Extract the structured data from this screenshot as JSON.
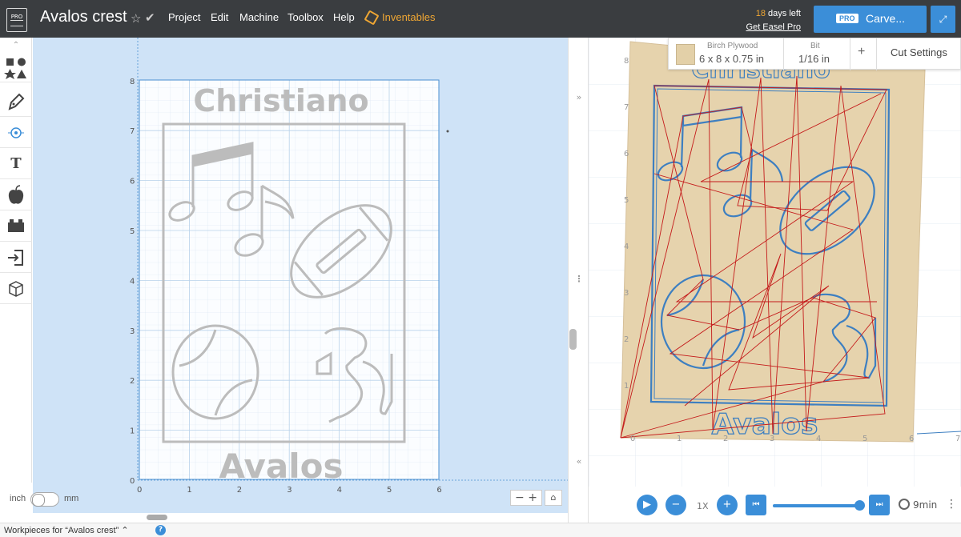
{
  "header": {
    "logo_text": "PRO",
    "project_title": "Avalos crest",
    "menu": [
      "Project",
      "Edit",
      "Machine",
      "Toolbox",
      "Help",
      "Inventables"
    ],
    "trial_days": "18",
    "trial_suffix": " days left",
    "trial_link": "Get Easel Pro",
    "carve_badge": "PRO",
    "carve_label": "Carve..."
  },
  "tools": [
    "shapes-icon",
    "pen-icon",
    "point-icon",
    "text-icon",
    "apple-icon",
    "brick-icon",
    "import-icon",
    "cube-icon"
  ],
  "design": {
    "text_top": "Christiano",
    "text_bottom": "Avalos",
    "x_ticks": [
      "0",
      "1",
      "2",
      "3",
      "4",
      "5",
      "6"
    ],
    "y_ticks": [
      "0",
      "1",
      "2",
      "3",
      "4",
      "5",
      "6",
      "7",
      "8"
    ]
  },
  "units": {
    "left": "inch",
    "right": "mm"
  },
  "zoom": {
    "minus": "−",
    "plus": "+",
    "home": "⌂"
  },
  "material": {
    "name": "Birch Plywood",
    "dimensions": "6 x 8 x 0.75 in",
    "bit_label": "Bit",
    "bit_value": "1/16 in",
    "add": "+",
    "cut_settings": "Cut Settings"
  },
  "preview": {
    "text_top": "Christiano",
    "text_bottom": "Avalos",
    "x_ticks": [
      "0",
      "1",
      "2",
      "3",
      "4",
      "5",
      "6",
      "7"
    ],
    "y_ticks": [
      "1",
      "2",
      "3",
      "4",
      "5",
      "6",
      "7",
      "8"
    ]
  },
  "playback": {
    "speed": "1X",
    "time": "9min",
    "progress": 1.0
  },
  "bottom": {
    "workpieces": "Workpieces for “Avalos crest”",
    "chevron": "⌃",
    "help": "?"
  },
  "colors": {
    "topbar": "#3a3d40",
    "accent": "#3b8ed8",
    "inventables": "#f0a733",
    "design_bg": "#cfe3f7",
    "shape_gray": "#bcbcbc",
    "wood": "#e3d0a8",
    "toolpath_blue": "#3d7fc1",
    "toolpath_red": "#c41a1a"
  }
}
